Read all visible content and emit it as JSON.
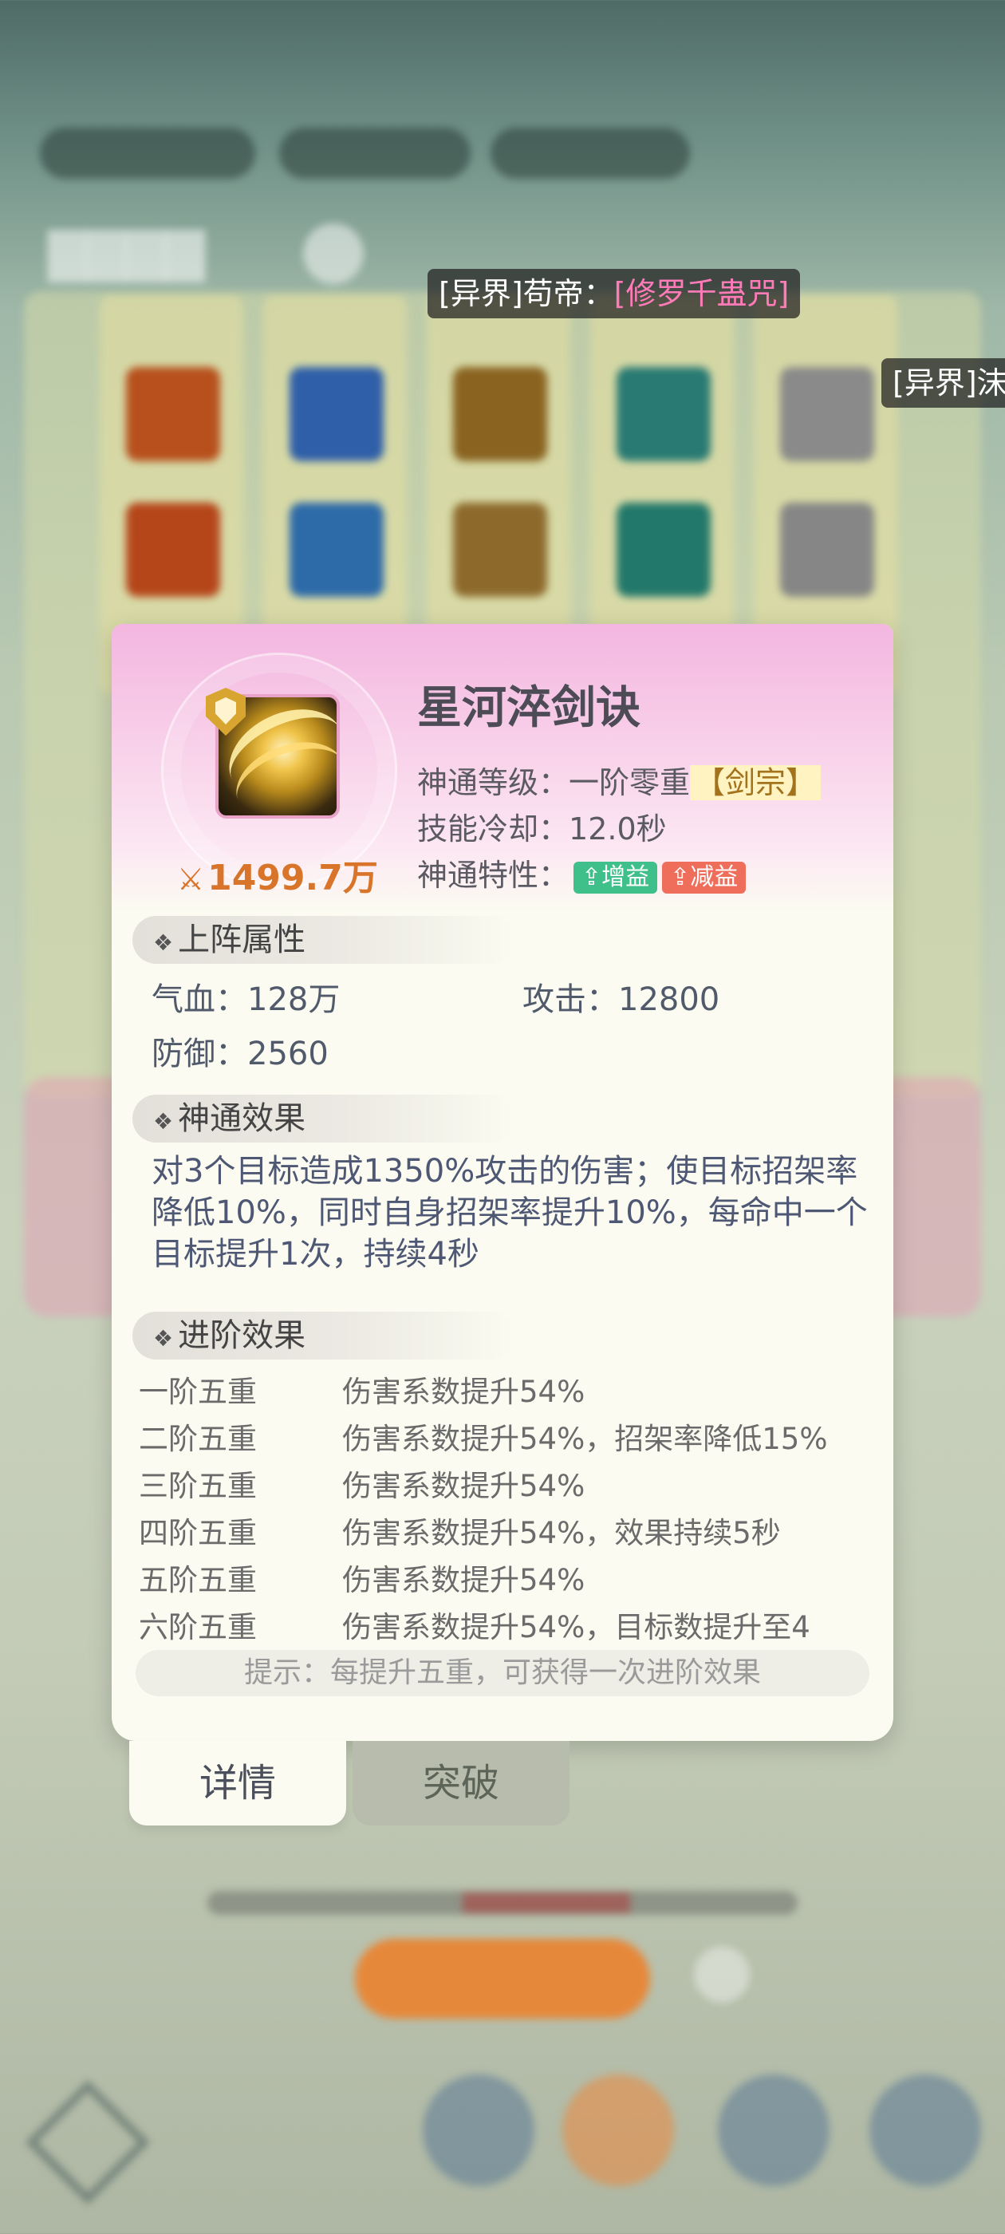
{
  "barrages": [
    {
      "prefix": "[异界]苟帝：",
      "highlight": "[修罗千蛊咒]"
    },
    {
      "prefix": "[异界]沫",
      "highlight": ""
    }
  ],
  "skill": {
    "name": "星河淬剑诀",
    "power": "1499.7万",
    "level_label": "神通等级：",
    "level_value": "一阶零重",
    "sect": "【剑宗】",
    "cooldown_label": "技能冷却：",
    "cooldown_value": "12.0秒",
    "trait_label": "神通特性：",
    "tags": [
      "增益",
      "减益"
    ]
  },
  "sections": {
    "attributes_title": "上阵属性",
    "effect_title": "神通效果",
    "advance_title": "进阶效果"
  },
  "attributes": {
    "hp": "气血：128万",
    "attack": "攻击：12800",
    "defense": "防御：2560"
  },
  "effect_text": "对3个目标造成1350%攻击的伤害；使目标招架率降低10%，同时自身招架率提升10%，每命中一个目标提升1次，持续4秒",
  "advances": [
    {
      "level": "一阶五重",
      "desc": "伤害系数提升54%"
    },
    {
      "level": "二阶五重",
      "desc": "伤害系数提升54%，招架率降低15%"
    },
    {
      "level": "三阶五重",
      "desc": "伤害系数提升54%"
    },
    {
      "level": "四阶五重",
      "desc": "伤害系数提升54%，效果持续5秒"
    },
    {
      "level": "五阶五重",
      "desc": "伤害系数提升54%"
    },
    {
      "level": "六阶五重",
      "desc": "伤害系数提升54%，目标数提升至4"
    }
  ],
  "tip": "提示：每提升五重，可获得一次进阶效果",
  "tabs": {
    "details": "详情",
    "breakthrough": "突破"
  },
  "colors": {
    "power": "#d9752b",
    "buff_tag": "#3fbf8a",
    "debuff_tag": "#ef6d5b",
    "barrage_highlight": "#ff7bb8"
  }
}
